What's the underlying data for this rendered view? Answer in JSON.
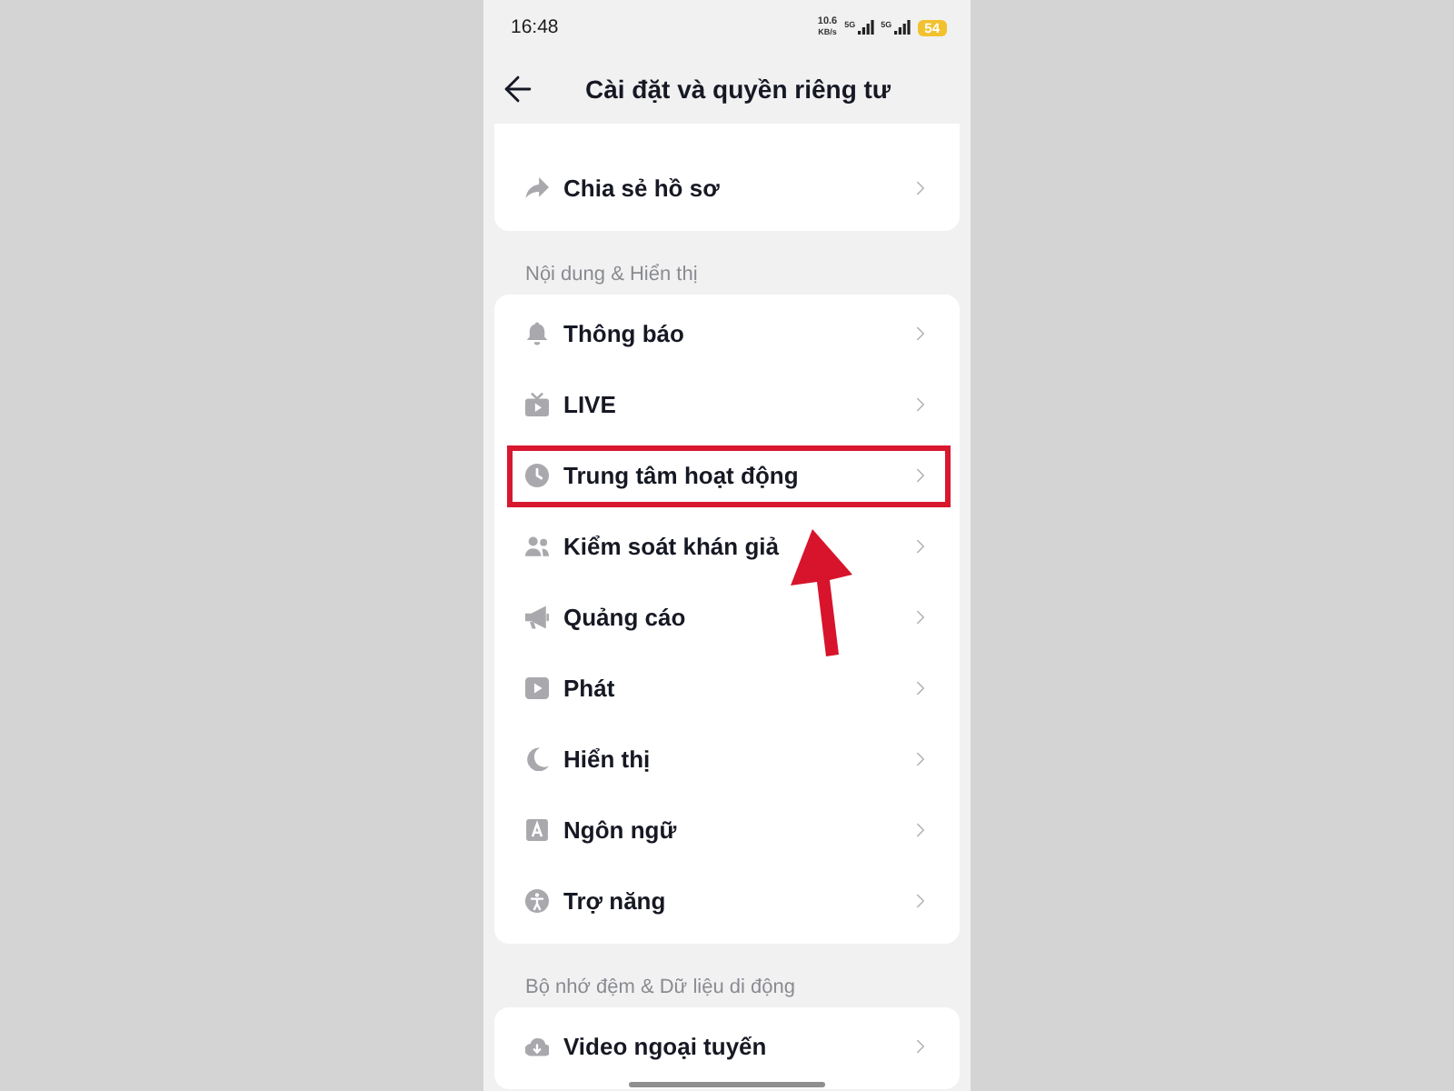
{
  "status_bar": {
    "time": "16:48",
    "network_speed": "10.6",
    "network_speed_unit": "KB/s",
    "signals": [
      {
        "label": "5G"
      },
      {
        "label": "5G"
      }
    ],
    "battery": "54"
  },
  "header": {
    "title": "Cài đặt và quyền riêng tư"
  },
  "sections": [
    {
      "items": [
        {
          "label": "Chia sẻ hồ sơ",
          "highlighted": false
        }
      ]
    },
    {
      "heading": "Nội dung & Hiển thị",
      "items": [
        {
          "label": "Thông báo",
          "highlighted": false
        },
        {
          "label": "LIVE",
          "highlighted": false
        },
        {
          "label": "Trung tâm hoạt động",
          "highlighted": true
        },
        {
          "label": "Kiểm soát khán giả",
          "highlighted": false
        },
        {
          "label": "Quảng cáo",
          "highlighted": false
        },
        {
          "label": "Phát",
          "highlighted": false
        },
        {
          "label": "Hiển thị",
          "highlighted": false
        },
        {
          "label": "Ngôn ngữ",
          "highlighted": false
        },
        {
          "label": "Trợ năng",
          "highlighted": false
        }
      ]
    },
    {
      "heading": "Bộ nhớ đệm & Dữ liệu di động",
      "items": [
        {
          "label": "Video ngoại tuyến",
          "highlighted": false
        }
      ]
    }
  ]
}
